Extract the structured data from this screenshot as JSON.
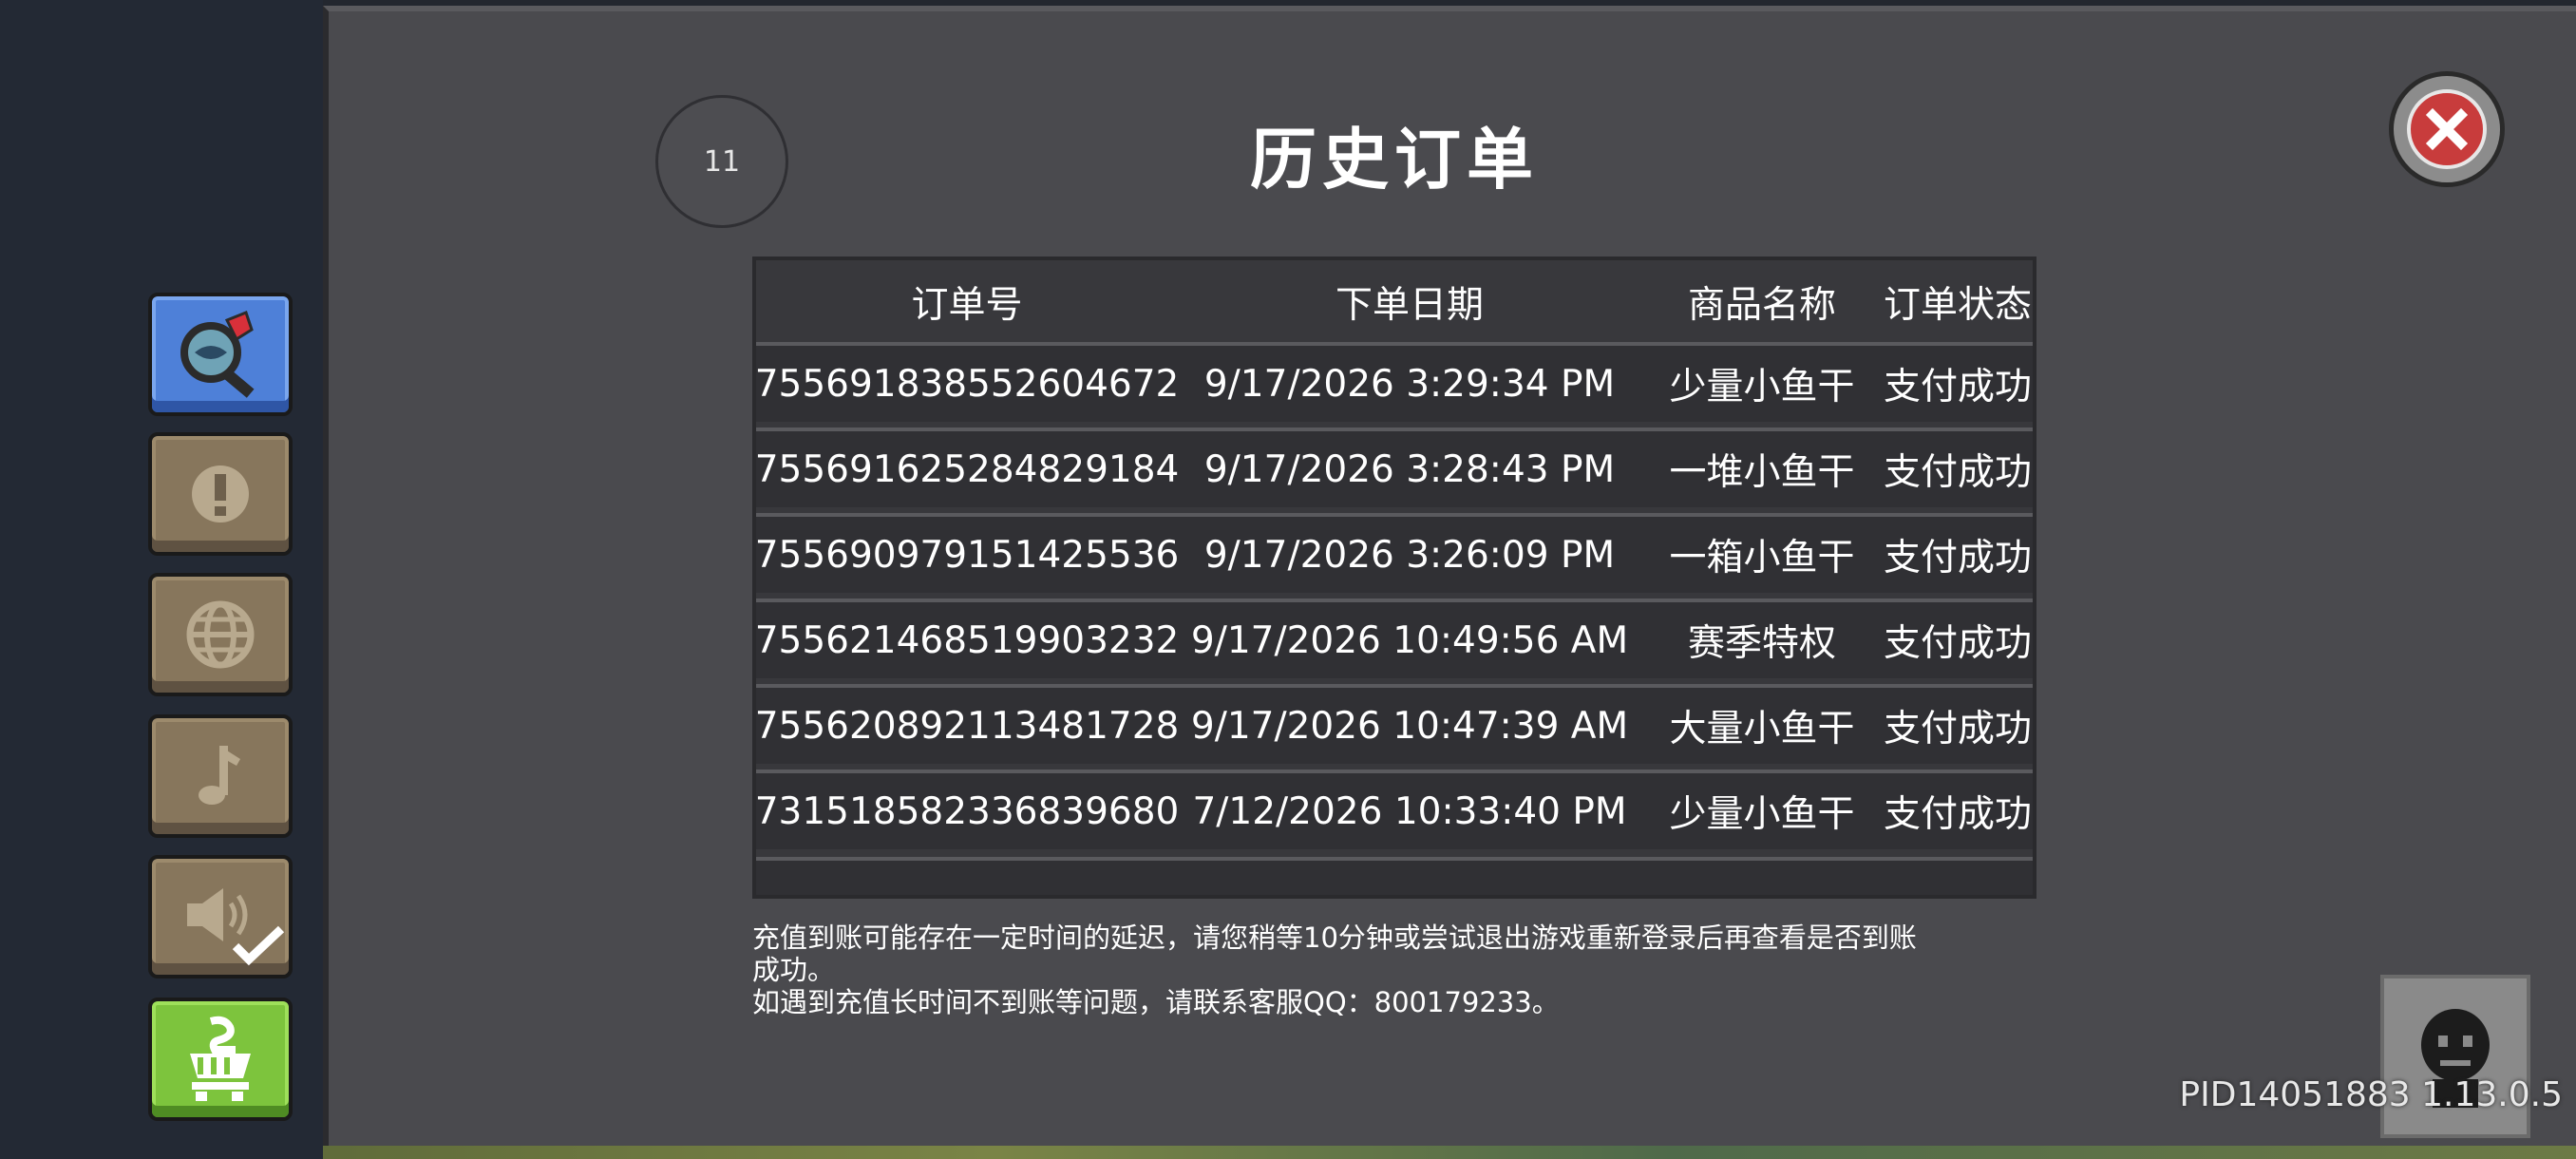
{
  "sidebar": {
    "items": [
      {
        "name": "search-map",
        "active": true
      },
      {
        "name": "notice"
      },
      {
        "name": "language"
      },
      {
        "name": "music"
      },
      {
        "name": "sound",
        "checked": true
      },
      {
        "name": "shop"
      }
    ]
  },
  "header": {
    "badge": "11",
    "title": "历史订单"
  },
  "table": {
    "columns": [
      "订单号",
      "下单日期",
      "商品名称",
      "订单状态"
    ],
    "rows": [
      [
        "755691838552604672",
        "9/17/2026 3:29:34 PM",
        "少量小鱼干",
        "支付成功"
      ],
      [
        "755691625284829184",
        "9/17/2026 3:28:43 PM",
        "一堆小鱼干",
        "支付成功"
      ],
      [
        "755690979151425536",
        "9/17/2026 3:26:09 PM",
        "一箱小鱼干",
        "支付成功"
      ],
      [
        "755621468519903232",
        "9/17/2026 10:49:56 AM",
        "赛季特权",
        "支付成功"
      ],
      [
        "755620892113481728",
        "9/17/2026 10:47:39 AM",
        "大量小鱼干",
        "支付成功"
      ],
      [
        "731518582336839680",
        "7/12/2026 10:33:40 PM",
        "少量小鱼干",
        "支付成功"
      ]
    ]
  },
  "notice": {
    "line1": "充值到账可能存在一定时间的延迟，请您稍等10分钟或尝试退出游戏重新登录后再查看是否到账",
    "line2": "成功。",
    "line3": "如遇到充值长时间不到账等问题，请联系客服QQ：800179233。"
  },
  "footer": {
    "pid": "PID14051883 1.13.0.5"
  },
  "colors": {
    "panel": "#4a4a4e",
    "sidebar": "#232934",
    "close": "#c83c3c",
    "shop": "#7dc43d",
    "active": "#4e80d8"
  }
}
